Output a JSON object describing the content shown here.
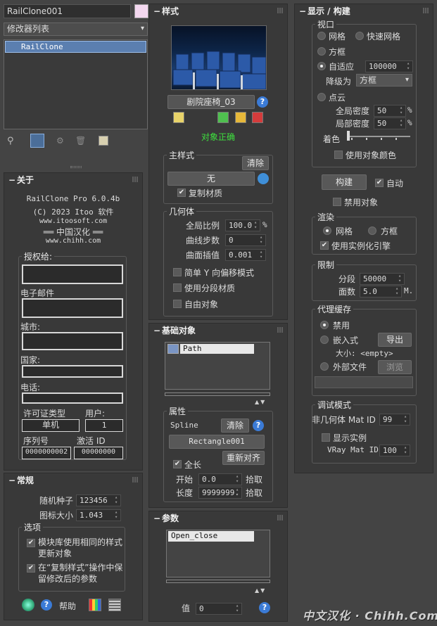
{
  "left": {
    "object_name": "RailClone001",
    "modifier_list": "修改器列表",
    "stack_item": "RailClone",
    "about": {
      "title": "关于",
      "line1": "RailClone Pro 6.0.4b",
      "line2": "(C) 2023 Itoo 软件",
      "line3": "www.itoosoft.com",
      "line4": "══ 中国汉化 ══",
      "line5": "www.chihh.com",
      "licensed_to": "授权给:",
      "email": "电子邮件",
      "city": "城市:",
      "country": "国家:",
      "phone": "电话:",
      "license_type": "许可证类型",
      "users": "用户:",
      "license_value": "单机",
      "users_value": "1",
      "serial": "序列号",
      "activation": "激活 ID",
      "serial_value": "0000000002",
      "activation_value": "00000000"
    },
    "general": {
      "title": "常规",
      "seed_label": "随机种子",
      "seed_value": "123456",
      "icon_size_label": "图标大小",
      "icon_size_value": "1.043",
      "options": "选项",
      "opt1": "模块库使用相同的样式更新对象",
      "opt2": "在“复制样式”操作中保留修改后的参数",
      "help": "帮助"
    }
  },
  "middle": {
    "style": {
      "title": "样式",
      "style_name": "剧院座椅_03",
      "status": "对象正确",
      "main_style": "主样式",
      "clear": "清除",
      "none": "无",
      "copy_material": "复制材质"
    },
    "geometry": {
      "title": "几何体",
      "global_scale": "全局比例",
      "global_scale_value": "100.0",
      "pct": "%",
      "curve_steps": "曲线步数",
      "curve_steps_value": "0",
      "surface_interp": "曲面插值",
      "surface_interp_value": "0.001",
      "simple_y": "简单 Y 向偏移模式",
      "segment_mat": "使用分段材质",
      "free_obj": "自由对象"
    },
    "base": {
      "title": "基础对象",
      "path": "Path",
      "props": "属性",
      "spline": "Spline",
      "clear": "清除",
      "rect": "Rectangle001",
      "full_length": "全长",
      "realign": "重新对齐",
      "start": "开始",
      "start_value": "0.0",
      "pick": "拾取",
      "length": "长度",
      "length_value": "9999999."
    },
    "params": {
      "title": "参数",
      "item": "Open_close",
      "value_label": "值",
      "value": "0"
    }
  },
  "right": {
    "display": {
      "title": "显示 / 构建",
      "viewport": "视口",
      "grid": "网格",
      "fast_grid": "快速网格",
      "box": "方框",
      "adaptive": "自适应",
      "adaptive_value": "100000",
      "degrade": "降级为",
      "degrade_value": "方框",
      "point_cloud": "点云",
      "global_density": "全局密度",
      "global_density_value": "50",
      "local_density": "局部密度",
      "local_density_value": "50",
      "pct": "%",
      "tint": "着色",
      "use_obj_color": "使用对象颜色",
      "build": "构建",
      "auto": "自动",
      "disable_obj": "禁用对象"
    },
    "render": {
      "title": "渲染",
      "grid": "网格",
      "box": "方框",
      "instancing": "使用实例化引擎"
    },
    "limit": {
      "title": "限制",
      "segments": "分段",
      "segments_value": "50000",
      "faces": "面数",
      "faces_value": "5.0",
      "m": "M."
    },
    "proxy": {
      "title": "代理缓存",
      "disable": "禁用",
      "embedded": "嵌入式",
      "export": "导出",
      "size": "大小: <empty>",
      "external": "外部文件",
      "browse": "浏览"
    },
    "debug": {
      "title": "调试模式",
      "non_geom": "非几何体 Mat ID",
      "non_geom_value": "99",
      "show_inst": "显示实例",
      "vray": "VRay Mat ID",
      "vray_value": "100"
    }
  },
  "watermark": "中文汉化 · Chihh.Com"
}
